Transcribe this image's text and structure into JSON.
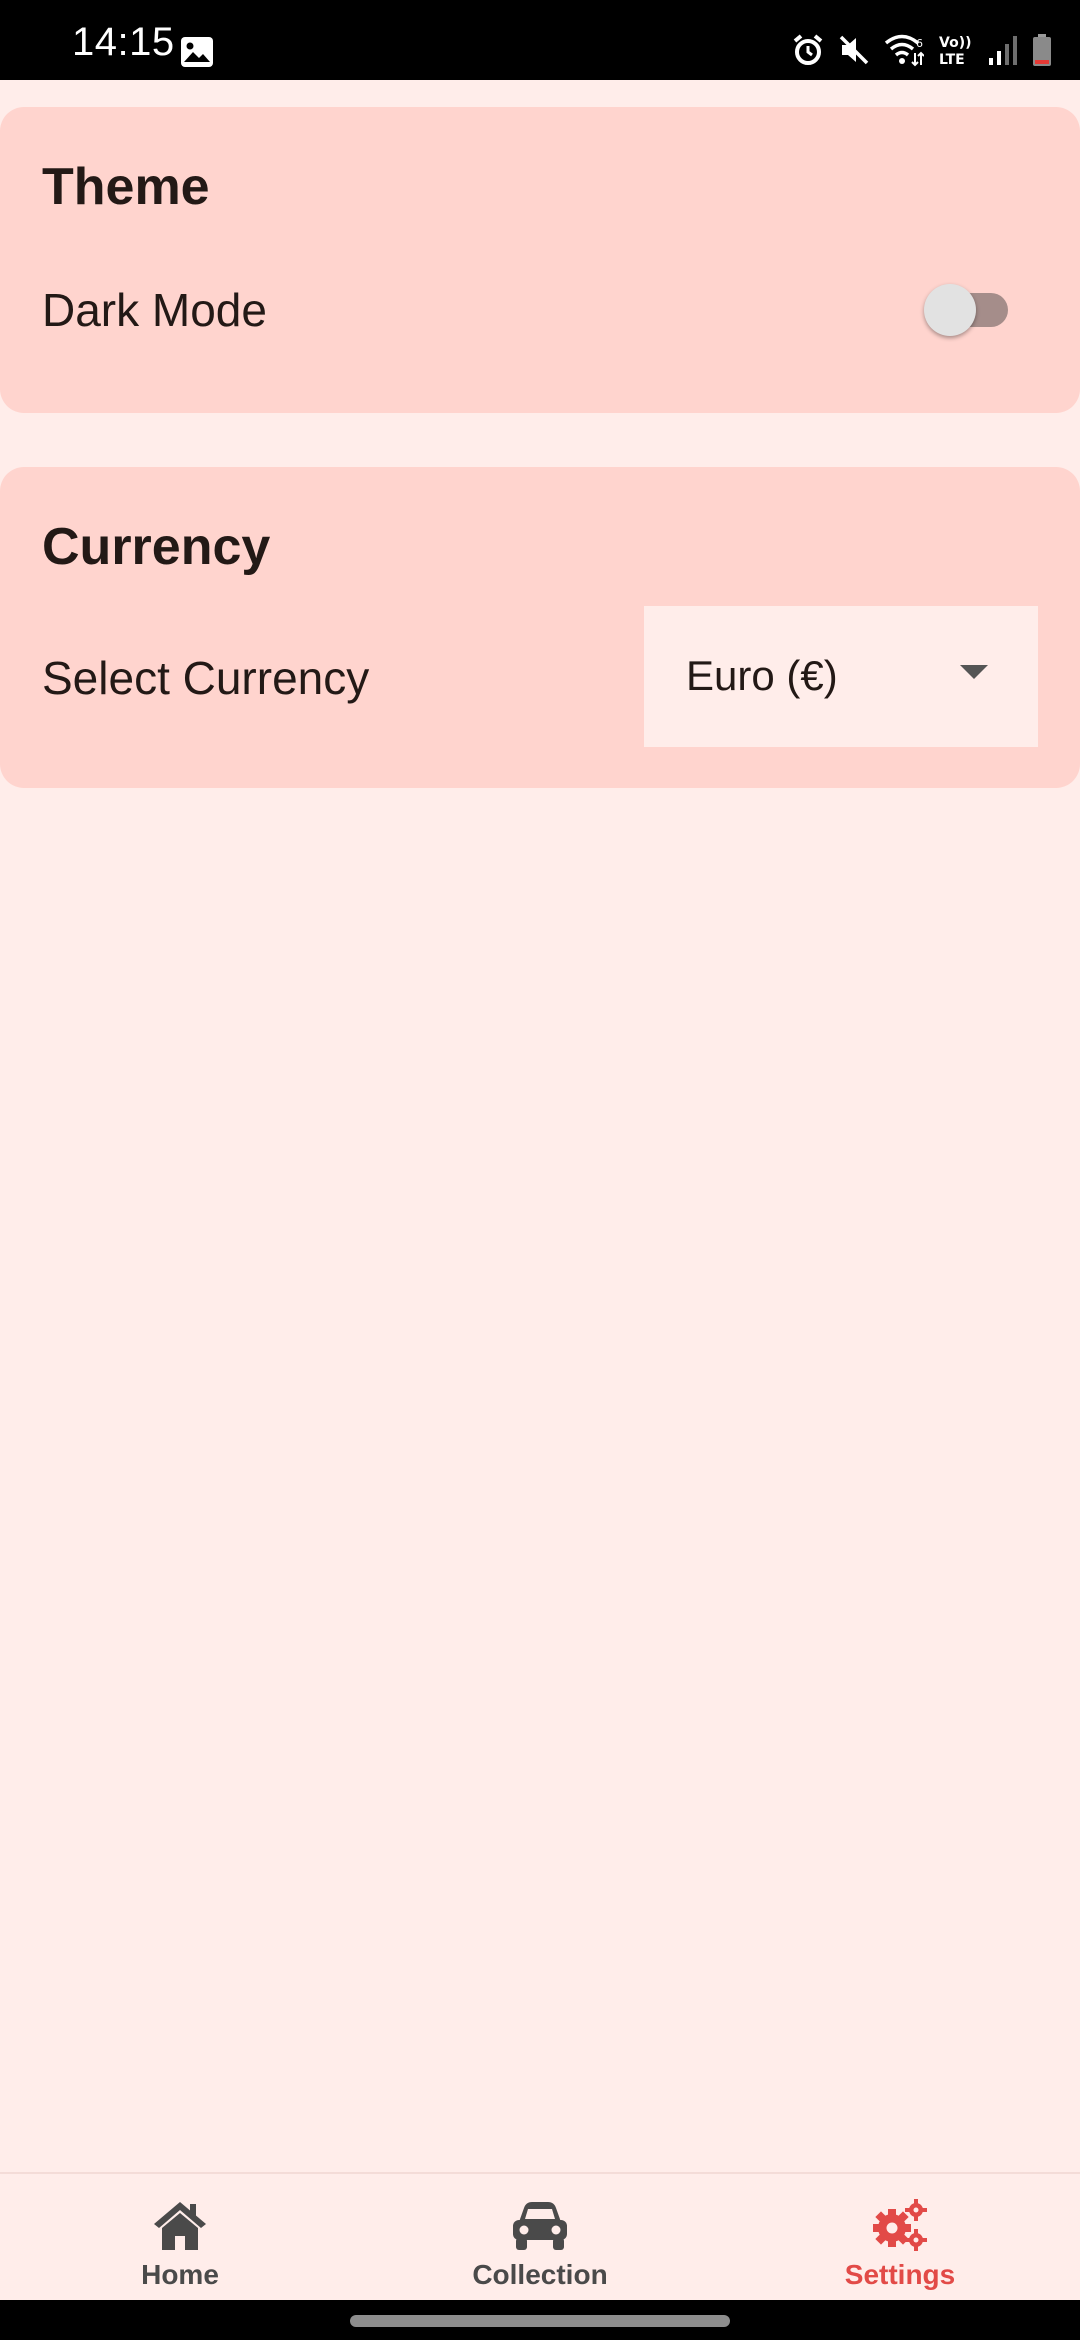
{
  "status_bar": {
    "time": "14:15",
    "icons": [
      "gallery-icon",
      "alarm-icon",
      "mute-icon",
      "wifi-icon",
      "volte-icon",
      "signal-icon",
      "battery-icon"
    ],
    "volte_top": "Vo))",
    "volte_bottom": "LTE"
  },
  "theme_card": {
    "title": "Theme",
    "dark_mode_label": "Dark Mode",
    "dark_mode_enabled": false
  },
  "currency_card": {
    "title": "Currency",
    "select_label": "Select Currency",
    "selected_value": "Euro (€)"
  },
  "bottom_nav": {
    "items": [
      {
        "label": "Home",
        "icon": "home-icon",
        "active": false
      },
      {
        "label": "Collection",
        "icon": "car-icon",
        "active": false
      },
      {
        "label": "Settings",
        "icon": "gears-icon",
        "active": true
      }
    ]
  },
  "colors": {
    "background": "#FFEDEA",
    "card": "#FFD4CE",
    "accent": "#E24A47",
    "text": "#231916",
    "nav_inactive": "#4A4A4A"
  }
}
